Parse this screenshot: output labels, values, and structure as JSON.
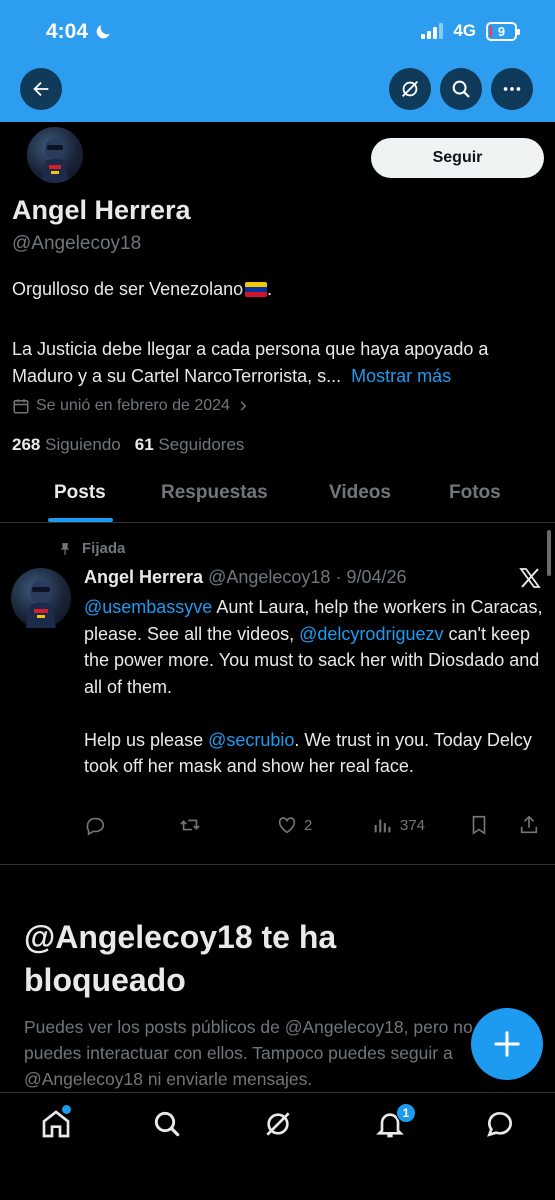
{
  "status_bar": {
    "time": "4:04",
    "network": "4G",
    "battery": "9",
    "battery_level": 0.09
  },
  "header_actions": {
    "back_icon": "arrow-left-icon",
    "grok_icon": "grok-icon",
    "search_icon": "search-icon",
    "more_icon": "more-dots-icon"
  },
  "profile": {
    "follow_label": "Seguir",
    "name": "Angel Herrera",
    "handle": "@Angelecoy18",
    "bio_line1": "Orgulloso de ser Venezolano",
    "bio_line2": "La Justicia debe llegar a cada persona que haya apoyado a Maduro y a su Cartel NarcoTerrorista, s...",
    "bio_more": "Mostrar más",
    "joined": "Se unió en febrero de 2024",
    "following_count": "268",
    "following_label": "Siguiendo",
    "followers_count": "61",
    "followers_label": "Seguidores"
  },
  "tabs": [
    {
      "label": "Posts",
      "active": true
    },
    {
      "label": "Respuestas",
      "active": false
    },
    {
      "label": "Videos",
      "active": false
    },
    {
      "label": "Fotos",
      "active": false
    }
  ],
  "post": {
    "pinned_label": "Fijada",
    "author_name": "Angel Herrera",
    "author_handle": "@Angelecoy18",
    "separator": " · ",
    "date": "9/04/26",
    "mention1": "@usembassyve",
    "text1": " Aunt Laura, help the workers in Caracas, please. See all the videos, ",
    "mention2": "@delcyrodriguezv",
    "text2": " can't keep the power more. You must to sack her with Diosdado and all of them.",
    "text3_before": "Help us please ",
    "mention3": "@secrubio",
    "text3_after": ". We trust in you. Today Delcy took off her mask and show her real face.",
    "likes": "2",
    "views": "374"
  },
  "blocked": {
    "title": "@Angelecoy18 te ha bloqueado",
    "description": "Puedes ver los posts públicos de @Angelecoy18, pero no puedes interactuar con ellos. Tampoco puedes seguir a @Angelecoy18 ni enviarle mensajes."
  },
  "bottom_nav": {
    "notifications_badge": "1"
  },
  "colors": {
    "banner": "#2d9df0",
    "accent": "#1d9bf0",
    "background": "#000000",
    "secondary_text": "#71767b"
  }
}
